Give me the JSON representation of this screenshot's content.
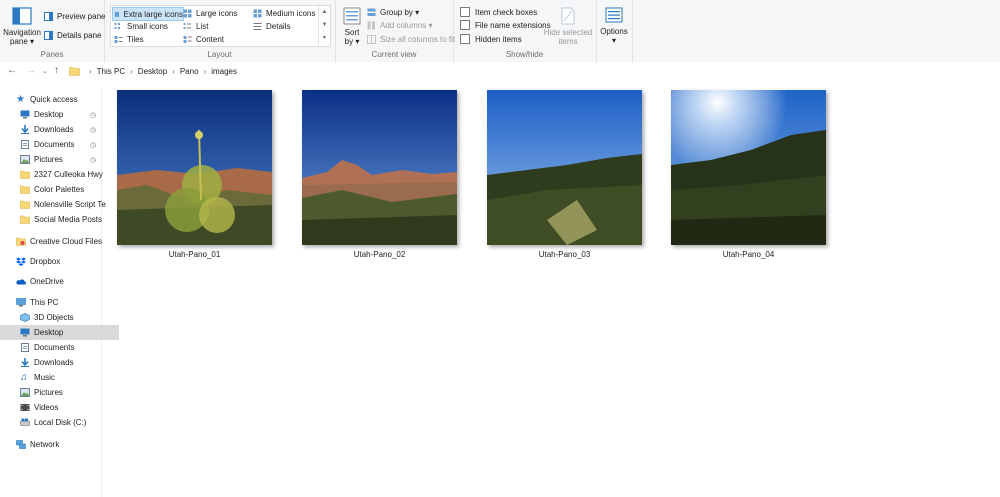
{
  "ribbon": {
    "panes": {
      "label": "Panes",
      "navigation_pane": "Navigation pane",
      "navigation_pane_line1": "Navigation",
      "navigation_pane_line2": "pane ▾",
      "preview_pane": "Preview pane",
      "details_pane": "Details pane"
    },
    "layout": {
      "label": "Layout",
      "options": [
        "Extra large icons",
        "Large icons",
        "Medium icons",
        "Small icons",
        "List",
        "Details",
        "Tiles",
        "Content"
      ],
      "selected": "Extra large icons"
    },
    "current_view": {
      "label": "Current view",
      "sort_line1": "Sort",
      "sort_line2": "by ▾",
      "group_by": "Group by ▾",
      "add_columns": "Add columns ▾",
      "size_all_columns": "Size all columns to fit"
    },
    "show_hide": {
      "label": "Show/hide",
      "item_check_boxes": "Item check boxes",
      "file_name_extensions": "File name extensions",
      "hidden_items": "Hidden items",
      "hide_selected_line1": "Hide selected",
      "hide_selected_line2": "items"
    },
    "options": {
      "line1": "Options",
      "line2": "▾"
    }
  },
  "address": {
    "crumbs": [
      "This PC",
      "Desktop",
      "Pano",
      "images"
    ]
  },
  "nav": {
    "quick_access": "Quick access",
    "quick_items": [
      "Desktop",
      "Downloads",
      "Documents",
      "Pictures",
      "2327 Culleoka Hwy",
      "Color Palettes",
      "Nolensville Script Te",
      "Social Media Posts"
    ],
    "creative_cloud": "Creative Cloud Files",
    "dropbox": "Dropbox",
    "onedrive": "OneDrive",
    "this_pc": "This PC",
    "pc_items": [
      "3D Objects",
      "Desktop",
      "Documents",
      "Downloads",
      "Music",
      "Pictures",
      "Videos",
      "Local Disk (C:)"
    ],
    "network": "Network",
    "selected": "Desktop"
  },
  "files": [
    {
      "name": "Utah-Pano_01"
    },
    {
      "name": "Utah-Pano_02"
    },
    {
      "name": "Utah-Pano_03"
    },
    {
      "name": "Utah-Pano_04"
    }
  ],
  "colors": {
    "accent": "#0078d7",
    "selection": "#cce4f7",
    "nav_selected": "#d9d9d9"
  }
}
